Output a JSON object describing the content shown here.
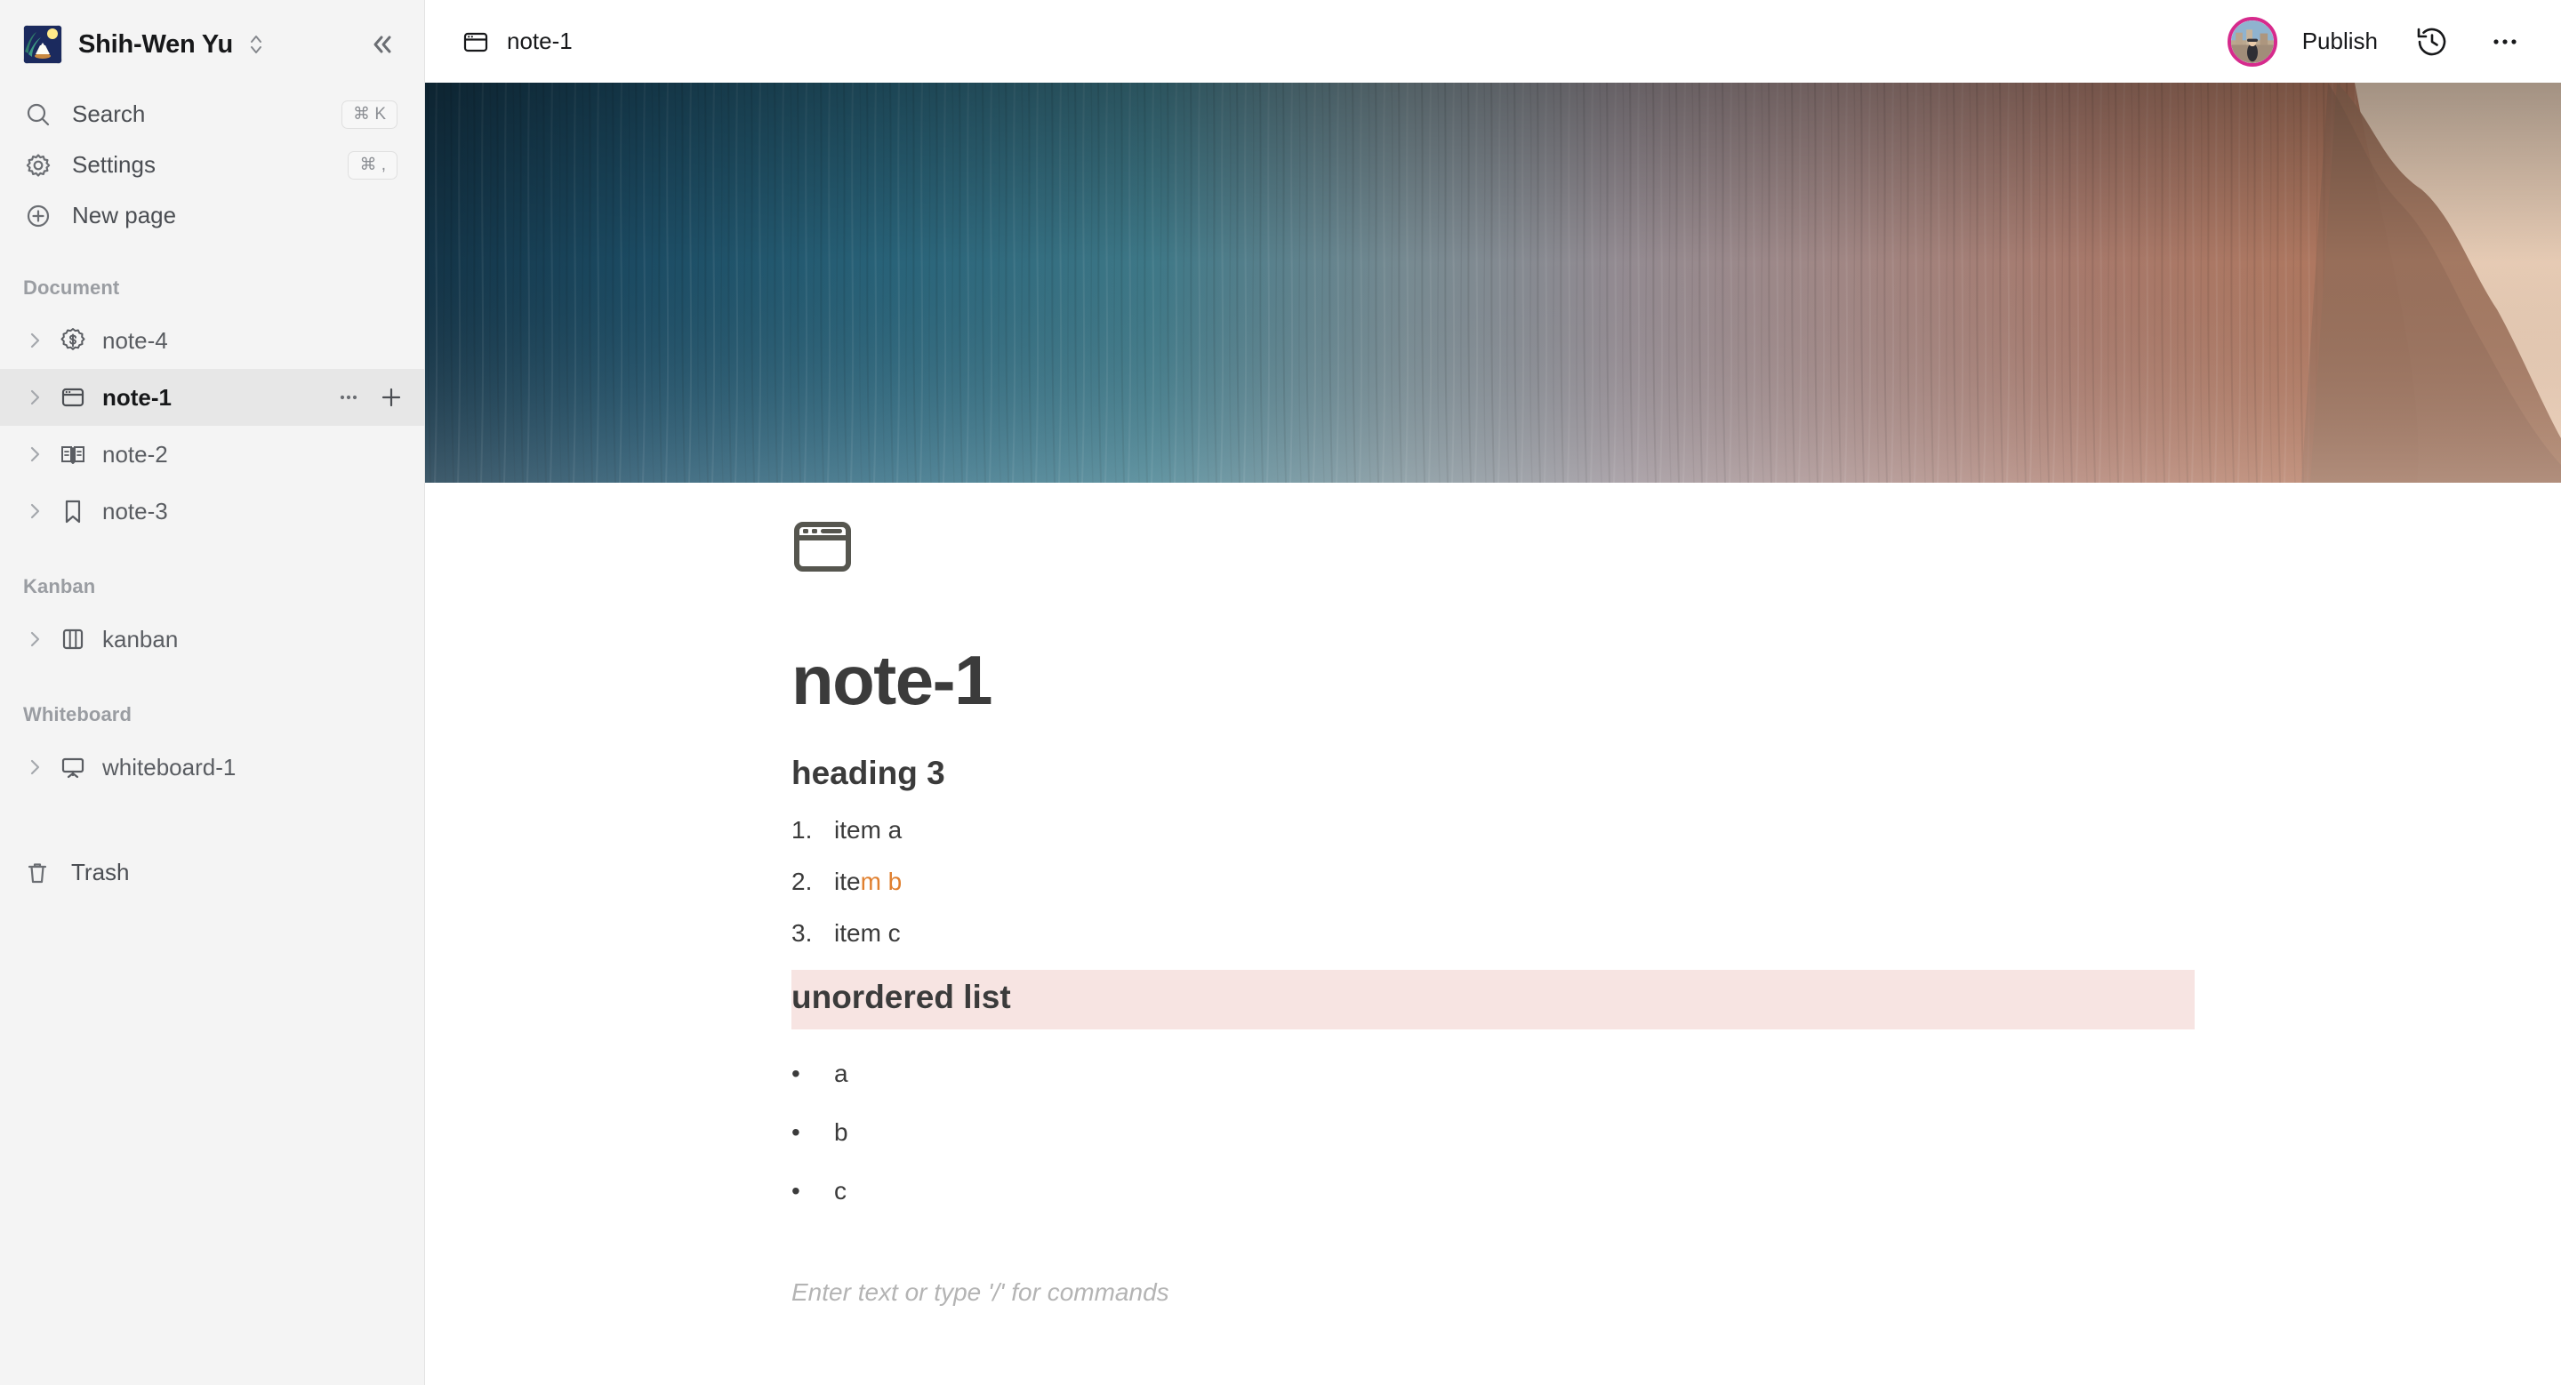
{
  "sidebar": {
    "workspace": {
      "name": "Shih-Wen Yu",
      "emoji_icon": "moon-viewing-ceremony-emoji",
      "switcher_icon": "chevron-up-down-icon",
      "collapse_icon": "double-chevron-left-icon"
    },
    "nav": [
      {
        "label": "Search",
        "icon": "search-icon",
        "shortcut": "⌘ K"
      },
      {
        "label": "Settings",
        "icon": "gear-icon",
        "shortcut": "⌘ ,"
      },
      {
        "label": "New page",
        "icon": "plus-circle-icon",
        "shortcut": ""
      }
    ],
    "sections": [
      {
        "title": "Document",
        "items": [
          {
            "label": "note-4",
            "icon": "dollar-badge-icon",
            "active": false
          },
          {
            "label": "note-1",
            "icon": "browser-window-icon",
            "active": true,
            "actions": [
              "more-icon",
              "plus-icon"
            ]
          },
          {
            "label": "note-2",
            "icon": "open-book-icon",
            "active": false
          },
          {
            "label": "note-3",
            "icon": "bookmark-icon",
            "active": false
          }
        ]
      },
      {
        "title": "Kanban",
        "items": [
          {
            "label": "kanban",
            "icon": "columns-icon",
            "active": false
          }
        ]
      },
      {
        "title": "Whiteboard",
        "items": [
          {
            "label": "whiteboard-1",
            "icon": "presentation-screen-icon",
            "active": false
          }
        ]
      }
    ],
    "trash": {
      "label": "Trash",
      "icon": "trash-icon"
    }
  },
  "topbar": {
    "breadcrumb": {
      "label": "note-1",
      "icon": "browser-window-icon"
    },
    "avatar_icon": "user-avatar",
    "avatar_ring_color": "#d62a8c",
    "publish_label": "Publish",
    "history_icon": "history-clock-icon",
    "more_icon": "more-horizontal-icon"
  },
  "document": {
    "cover_icon": "cover-image",
    "page_icon": "browser-window-icon",
    "title": "note-1",
    "heading3": "heading 3",
    "ordered_list": [
      {
        "num": "1.",
        "plain": "item a",
        "accent": ""
      },
      {
        "num": "2.",
        "plain": "ite",
        "accent": "m b"
      },
      {
        "num": "3.",
        "plain": "item c",
        "accent": ""
      }
    ],
    "highlight_block": {
      "text": "unordered list",
      "background": "#f7e4e2"
    },
    "unordered_list": [
      "a",
      "b",
      "c"
    ],
    "placeholder": "Enter text or type '/' for commands",
    "accent_color": "#e08030"
  }
}
